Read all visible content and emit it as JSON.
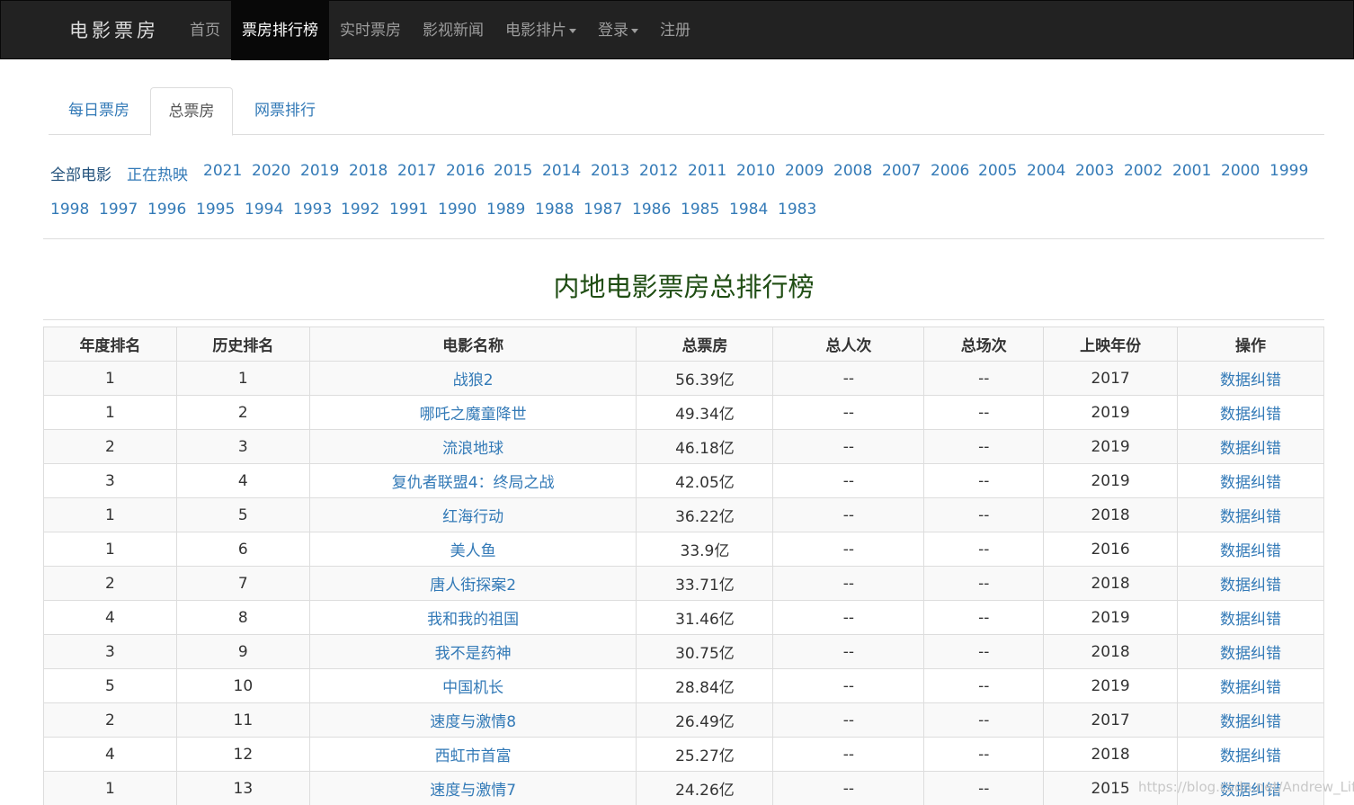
{
  "navbar": {
    "brand": "电影票房",
    "items": [
      {
        "label": "首页"
      },
      {
        "label": "票房排行榜",
        "active": true
      },
      {
        "label": "实时票房"
      },
      {
        "label": "影视新闻"
      },
      {
        "label": "电影排片",
        "dropdown": true
      },
      {
        "label": "登录",
        "dropdown": true
      },
      {
        "label": "注册"
      }
    ]
  },
  "tabs": [
    {
      "label": "每日票房"
    },
    {
      "label": "总票房",
      "active": true
    },
    {
      "label": "网票排行"
    }
  ],
  "filters": {
    "all": "全部电影",
    "hot": "正在热映",
    "years": [
      "2021",
      "2020",
      "2019",
      "2018",
      "2017",
      "2016",
      "2015",
      "2014",
      "2013",
      "2012",
      "2011",
      "2010",
      "2009",
      "2008",
      "2007",
      "2006",
      "2005",
      "2004",
      "2003",
      "2002",
      "2001",
      "2000",
      "1999",
      "1998",
      "1997",
      "1996",
      "1995",
      "1994",
      "1993",
      "1992",
      "1991",
      "1990",
      "1989",
      "1988",
      "1987",
      "1986",
      "1985",
      "1984",
      "1983"
    ]
  },
  "section_title": "内地电影票房总排行榜",
  "table": {
    "headers": [
      "年度排名",
      "历史排名",
      "电影名称",
      "总票房",
      "总人次",
      "总场次",
      "上映年份",
      "操作"
    ],
    "rows": [
      [
        "1",
        "1",
        "战狼2",
        "56.39亿",
        "--",
        "--",
        "2017",
        "数据纠错"
      ],
      [
        "1",
        "2",
        "哪吒之魔童降世",
        "49.34亿",
        "--",
        "--",
        "2019",
        "数据纠错"
      ],
      [
        "2",
        "3",
        "流浪地球",
        "46.18亿",
        "--",
        "--",
        "2019",
        "数据纠错"
      ],
      [
        "3",
        "4",
        "复仇者联盟4：终局之战",
        "42.05亿",
        "--",
        "--",
        "2019",
        "数据纠错"
      ],
      [
        "1",
        "5",
        "红海行动",
        "36.22亿",
        "--",
        "--",
        "2018",
        "数据纠错"
      ],
      [
        "1",
        "6",
        "美人鱼",
        "33.9亿",
        "--",
        "--",
        "2016",
        "数据纠错"
      ],
      [
        "2",
        "7",
        "唐人街探案2",
        "33.71亿",
        "--",
        "--",
        "2018",
        "数据纠错"
      ],
      [
        "4",
        "8",
        "我和我的祖国",
        "31.46亿",
        "--",
        "--",
        "2019",
        "数据纠错"
      ],
      [
        "3",
        "9",
        "我不是药神",
        "30.75亿",
        "--",
        "--",
        "2018",
        "数据纠错"
      ],
      [
        "5",
        "10",
        "中国机长",
        "28.84亿",
        "--",
        "--",
        "2019",
        "数据纠错"
      ],
      [
        "2",
        "11",
        "速度与激情8",
        "26.49亿",
        "--",
        "--",
        "2017",
        "数据纠错"
      ],
      [
        "4",
        "12",
        "西虹市首富",
        "25.27亿",
        "--",
        "--",
        "2018",
        "数据纠错"
      ],
      [
        "1",
        "13",
        "速度与激情7",
        "24.26亿",
        "--",
        "--",
        "2015",
        "数据纠错"
      ]
    ]
  },
  "watermark": "https://blog.csdn.net/Andrew_Lifeo"
}
